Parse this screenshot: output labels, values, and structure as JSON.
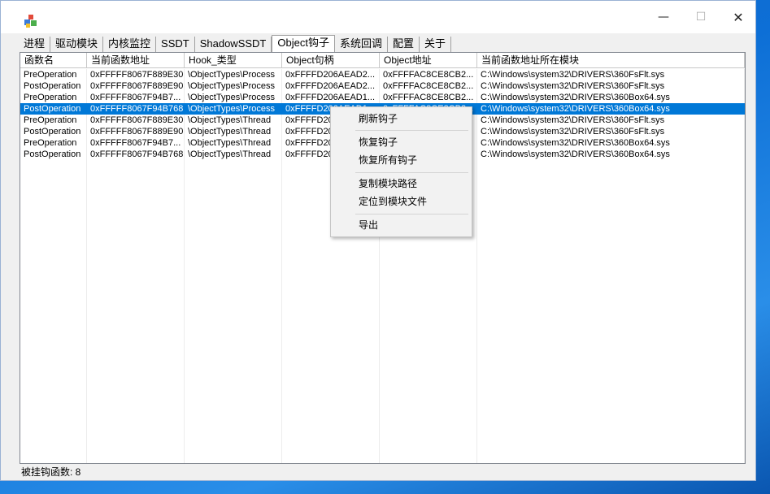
{
  "window": {
    "minimize": "—",
    "maximize": "☐",
    "close": "✕"
  },
  "tabs": [
    {
      "label": "进程"
    },
    {
      "label": "驱动模块"
    },
    {
      "label": "内核监控"
    },
    {
      "label": "SSDT"
    },
    {
      "label": "ShadowSSDT"
    },
    {
      "label": "Object钩子",
      "active": true
    },
    {
      "label": "系统回调"
    },
    {
      "label": "配置"
    },
    {
      "label": "关于"
    }
  ],
  "table": {
    "columns": [
      "函数名",
      "当前函数地址",
      "Hook_类型",
      "Object句柄",
      "Object地址",
      "当前函数地址所在模块"
    ],
    "rows": [
      [
        "PreOperation",
        "0xFFFFF8067F889E30",
        "\\ObjectTypes\\Process",
        "0xFFFFD206AEAD2...",
        "0xFFFFAC8CE8CB2...",
        "C:\\Windows\\system32\\DRIVERS\\360FsFlt.sys"
      ],
      [
        "PostOperation",
        "0xFFFFF8067F889E90",
        "\\ObjectTypes\\Process",
        "0xFFFFD206AEAD2...",
        "0xFFFFAC8CE8CB2...",
        "C:\\Windows\\system32\\DRIVERS\\360FsFlt.sys"
      ],
      [
        "PreOperation",
        "0xFFFFF8067F94B7...",
        "\\ObjectTypes\\Process",
        "0xFFFFD206AEAD1...",
        "0xFFFFAC8CE8CB2...",
        "C:\\Windows\\system32\\DRIVERS\\360Box64.sys"
      ],
      [
        "PostOperation",
        "0xFFFFF8067F94B768",
        "\\ObjectTypes\\Process",
        "0xFFFFD206AEAD1...",
        "0xFFFFAC8CE8CB2...",
        "C:\\Windows\\system32\\DRIVERS\\360Box64.sys"
      ],
      [
        "PreOperation",
        "0xFFFFF8067F889E30",
        "\\ObjectTypes\\Thread",
        "0xFFFFD20",
        "",
        "C:\\Windows\\system32\\DRIVERS\\360FsFlt.sys"
      ],
      [
        "PostOperation",
        "0xFFFFF8067F889E90",
        "\\ObjectTypes\\Thread",
        "0xFFFFD20",
        "",
        "C:\\Windows\\system32\\DRIVERS\\360FsFlt.sys"
      ],
      [
        "PreOperation",
        "0xFFFFF8067F94B7...",
        "\\ObjectTypes\\Thread",
        "0xFFFFD20",
        "",
        "C:\\Windows\\system32\\DRIVERS\\360Box64.sys"
      ],
      [
        "PostOperation",
        "0xFFFFF8067F94B768",
        "\\ObjectTypes\\Thread",
        "0xFFFFD20",
        "",
        "C:\\Windows\\system32\\DRIVERS\\360Box64.sys"
      ]
    ],
    "selected_row": 3
  },
  "context_menu": {
    "items": [
      "刷新钩子",
      "恢复钩子",
      "恢复所有钩子",
      "复制模块路径",
      "定位到模块文件",
      "导出"
    ]
  },
  "status": {
    "text": "被挂钩函数: 8"
  },
  "colors": {
    "selection": "#0078d7",
    "desktop": "#1565c0"
  }
}
